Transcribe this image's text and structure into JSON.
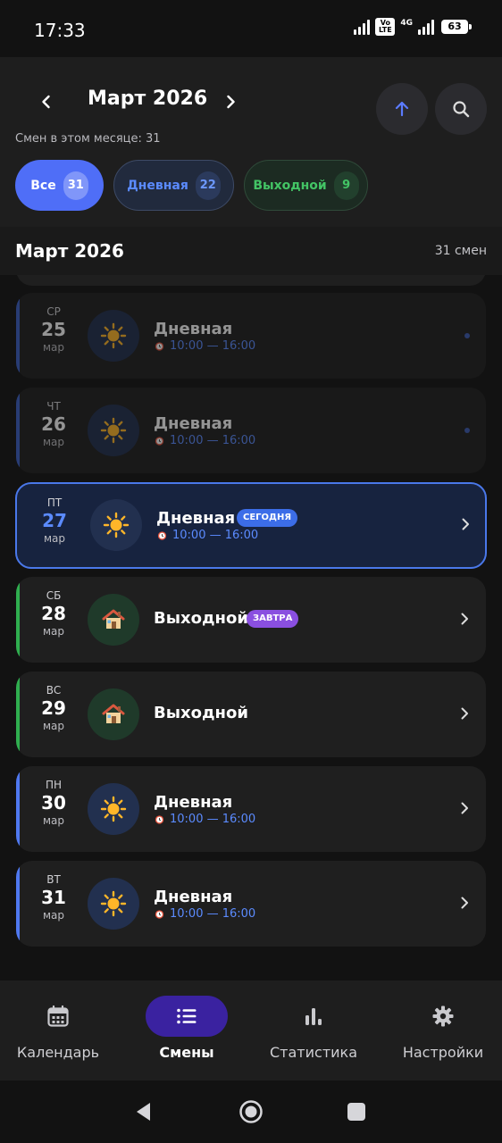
{
  "status_bar": {
    "time": "17:33",
    "volte": "Vo LTE",
    "network": "4G",
    "battery": "63"
  },
  "header": {
    "month_title": "Март 2026",
    "month_count": "Смен в этом месяце: 31",
    "filters": [
      {
        "label": "Все",
        "count": "31"
      },
      {
        "label": "Дневная",
        "count": "22"
      },
      {
        "label": "Выходной",
        "count": "9"
      }
    ]
  },
  "list": {
    "title": "Март 2026",
    "count": "31 смен",
    "items": [
      {
        "dow": "СР",
        "day": "25",
        "month": "мар",
        "name": "Дневная",
        "time": "10:00 — 16:00"
      },
      {
        "dow": "ЧТ",
        "day": "26",
        "month": "мар",
        "name": "Дневная",
        "time": "10:00 — 16:00"
      },
      {
        "dow": "ПТ",
        "day": "27",
        "month": "мар",
        "name": "Дневная",
        "time": "10:00 — 16:00",
        "badge": "СЕГОДНЯ"
      },
      {
        "dow": "СБ",
        "day": "28",
        "month": "мар",
        "name": "Выходной",
        "badge": "ЗАВТРА"
      },
      {
        "dow": "ВС",
        "day": "29",
        "month": "мар",
        "name": "Выходной"
      },
      {
        "dow": "ПН",
        "day": "30",
        "month": "мар",
        "name": "Дневная",
        "time": "10:00 — 16:00"
      },
      {
        "dow": "ВТ",
        "day": "31",
        "month": "мар",
        "name": "Дневная",
        "time": "10:00 — 16:00"
      }
    ]
  },
  "bottom_nav": [
    {
      "label": "Календарь",
      "icon": "calendar-icon"
    },
    {
      "label": "Смены",
      "icon": "list-icon"
    },
    {
      "label": "Статистика",
      "icon": "bar-chart-icon"
    },
    {
      "label": "Настройки",
      "icon": "gear-icon"
    }
  ],
  "colors": {
    "accent": "#4f6ef7",
    "day_shift": "#5b8bff",
    "day_off": "#43c465",
    "today_badge": "#3c6de8",
    "tomorrow_badge": "#8a4fe0",
    "nav_active": "#3a22a0"
  }
}
